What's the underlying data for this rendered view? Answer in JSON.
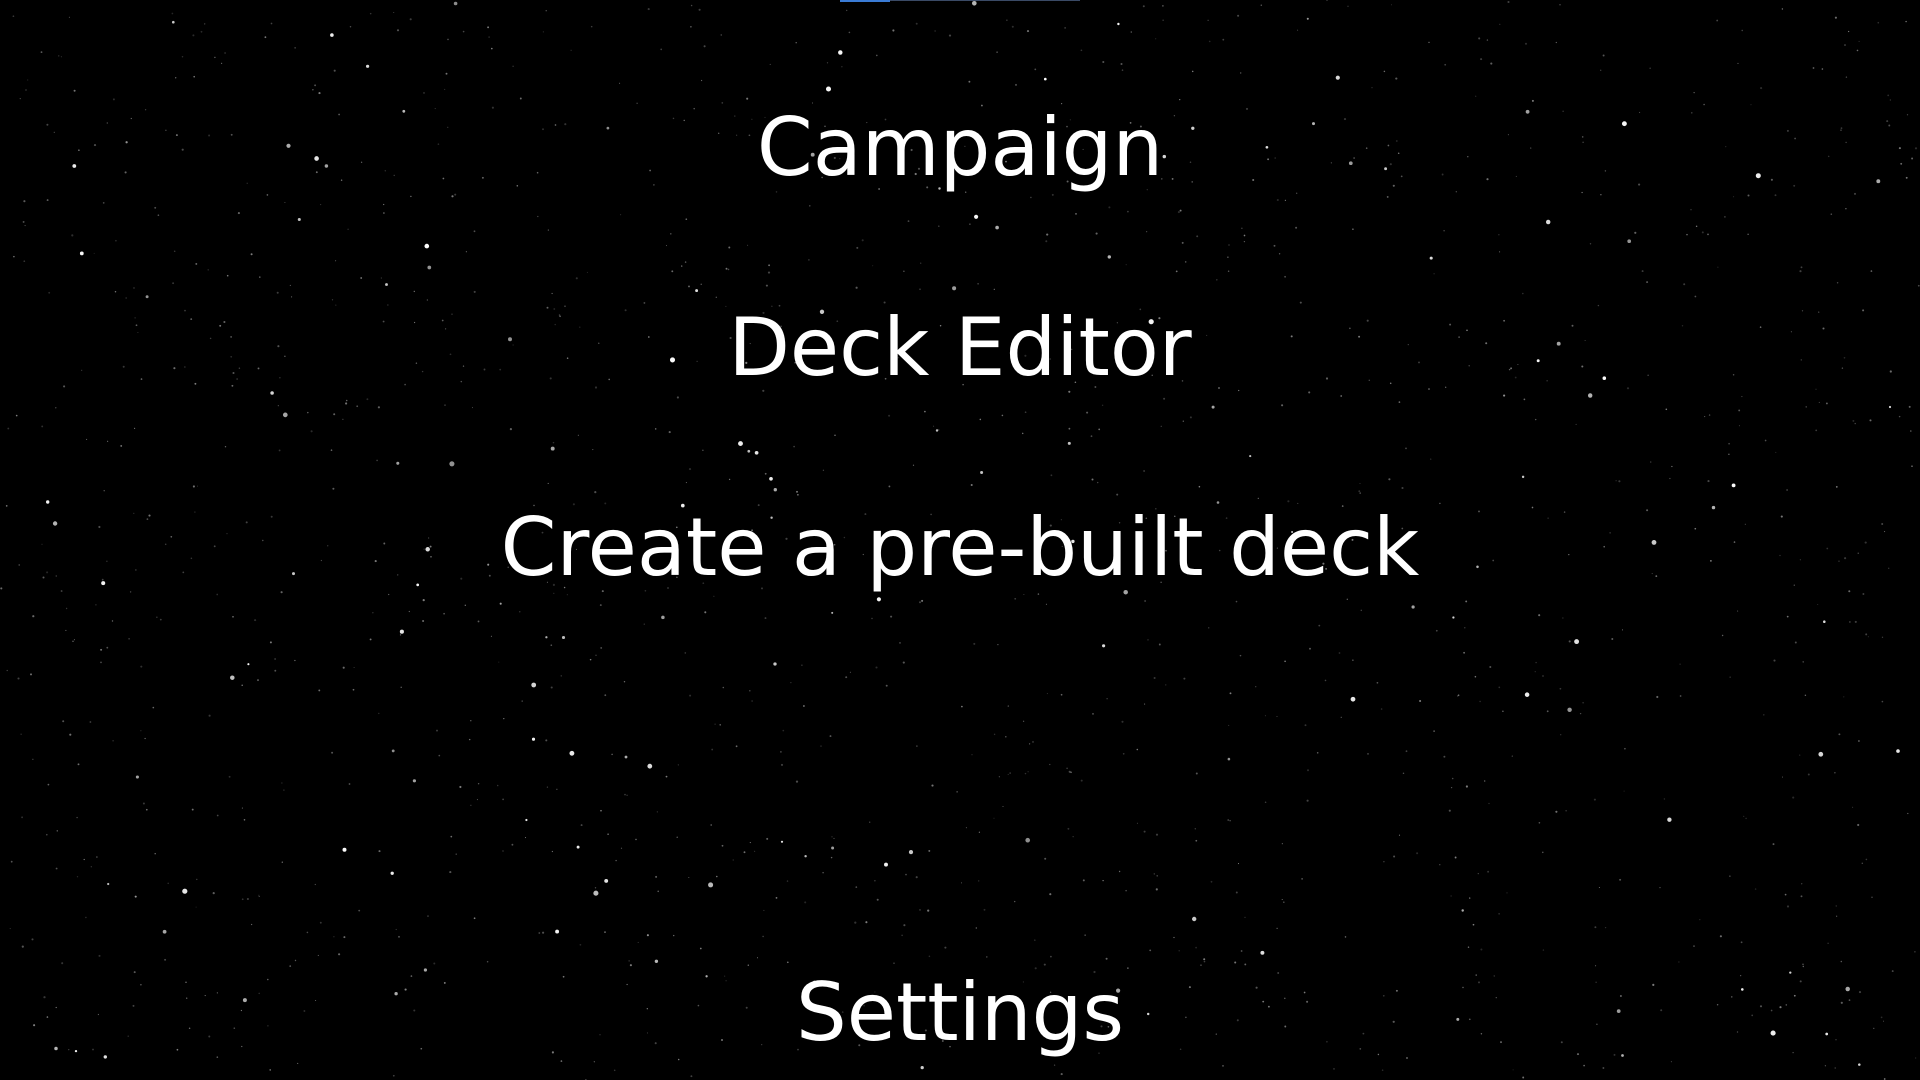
{
  "menu": {
    "campaign": "Campaign",
    "deck_editor": "Deck Editor",
    "create_prebuilt": "Create a pre-built deck",
    "settings": "Settings"
  },
  "colors": {
    "background": "#000000",
    "text": "#ffffff",
    "accent": "#3a7bd5"
  }
}
